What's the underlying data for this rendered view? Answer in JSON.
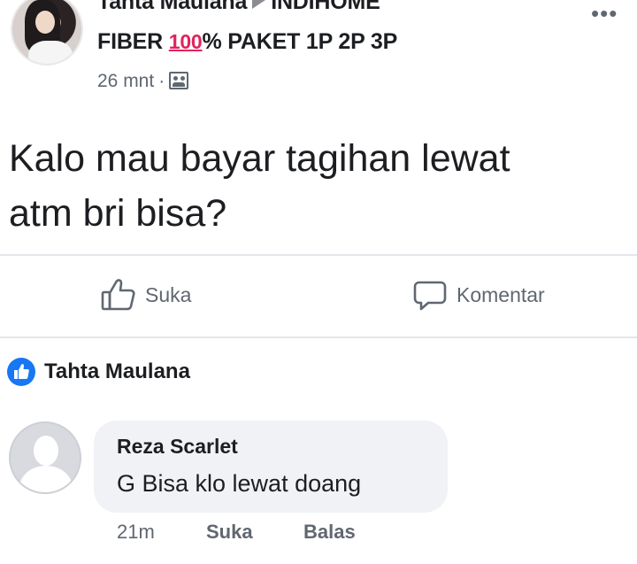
{
  "post": {
    "poster_name": "Tahta Maulana",
    "group_name_line1": "INDIHOME",
    "group_name_line2_prefix": "FIBER ",
    "emoji_100": "100",
    "group_name_line2_suffix": "% PAKET 1P 2P 3P",
    "time": "26 mnt",
    "separator": "·",
    "audience_icon": "group-icon",
    "more_icon": "more-horizontal-icon",
    "body_line1": "Kalo mau bayar tagihan lewat",
    "body_line2": "atm bri bisa?"
  },
  "actions": {
    "like_label": "Suka",
    "comment_label": "Komentar"
  },
  "reply_context": {
    "name": "Tahta Maulana",
    "icon": "like-thumb-badge-icon"
  },
  "comment": {
    "author": "Reza Scarlet",
    "text": "G Bisa klo lewat doang",
    "time": "21m",
    "like_label": "Suka",
    "reply_label": "Balas"
  },
  "colors": {
    "text": "#1c1e21",
    "secondary": "#606770",
    "accent": "#1877f2",
    "bubble": "#f0f2f5",
    "emoji_red": "#e0245e"
  }
}
